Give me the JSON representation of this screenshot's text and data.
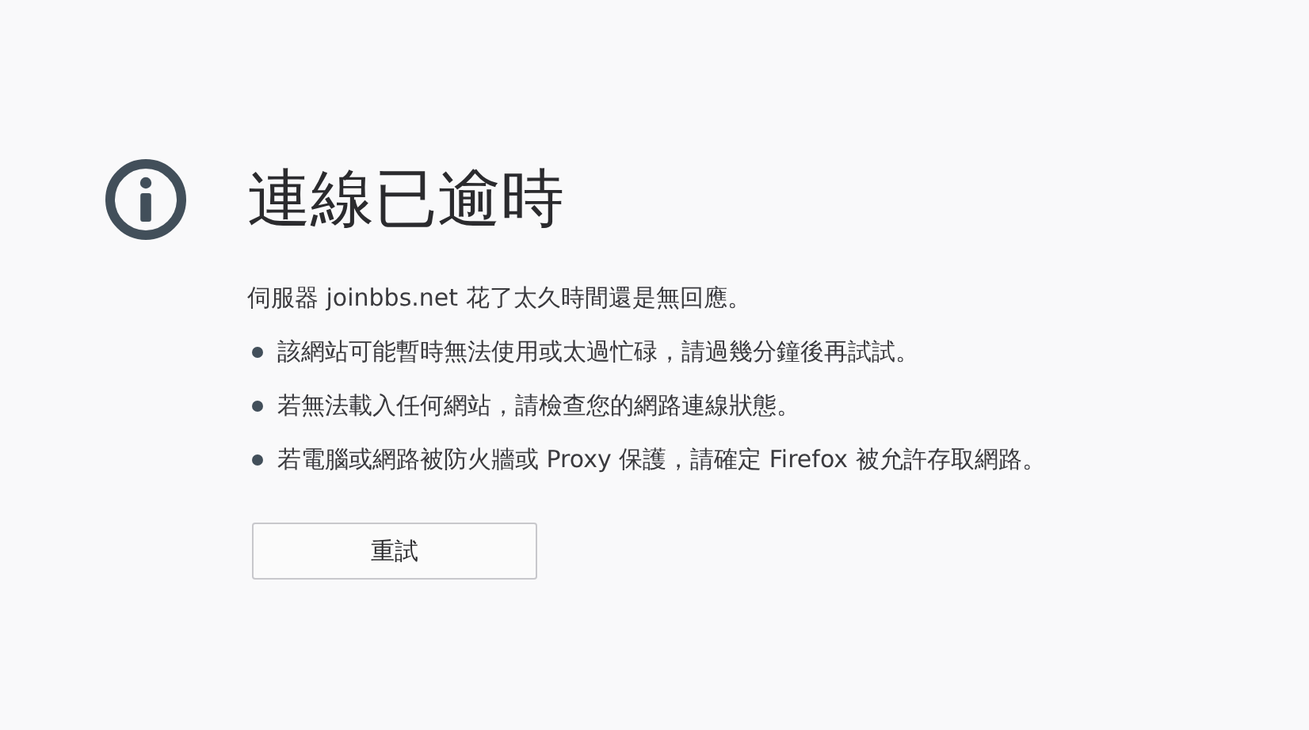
{
  "title": "連線已逾時",
  "description": "伺服器 joinbbs.net 花了太久時間還是無回應。",
  "suggestions": [
    "該網站可能暫時無法使用或太過忙碌，請過幾分鐘後再試試。",
    "若無法載入任何網站，請檢查您的網路連線狀態。",
    "若電腦或網路被防火牆或 Proxy 保護，請確定 Firefox 被允許存取網路。"
  ],
  "button": "重試"
}
